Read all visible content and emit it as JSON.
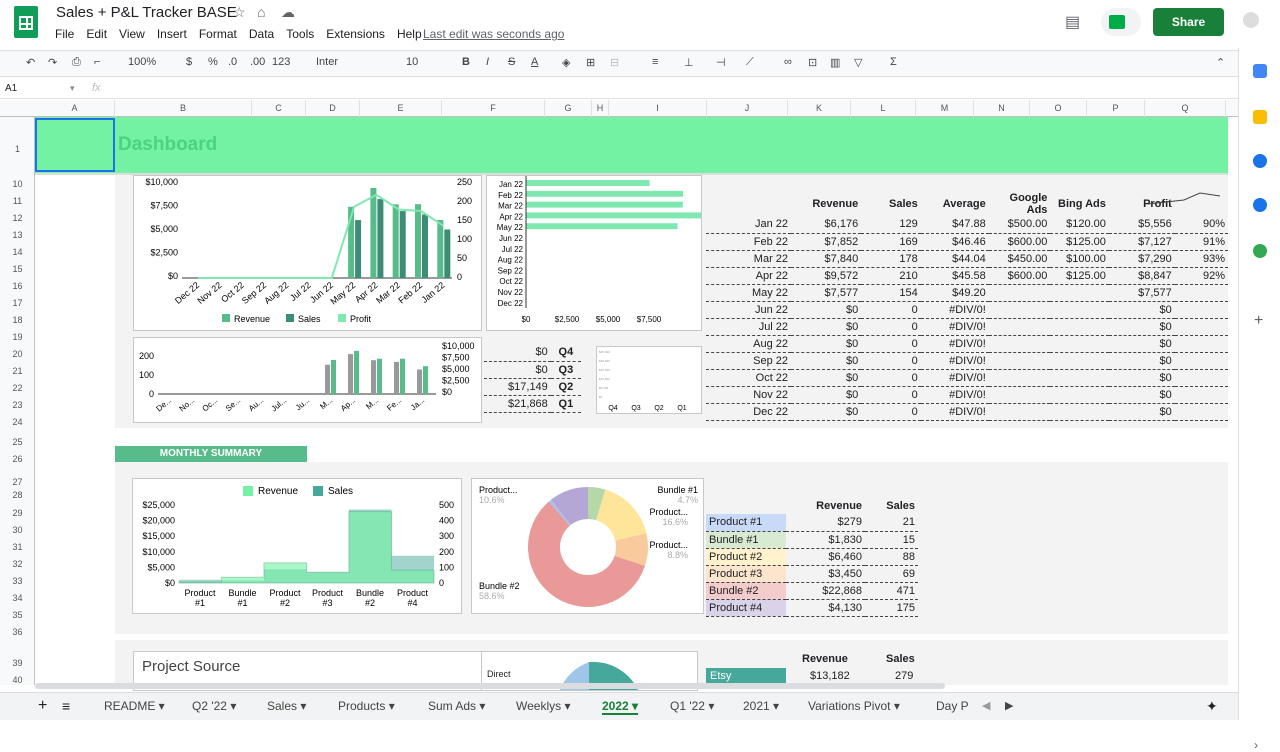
{
  "app": {
    "title": "Sales + P&L Tracker BASE",
    "last_edit": "Last edit was seconds ago",
    "share": "Share"
  },
  "menus": [
    "File",
    "Edit",
    "View",
    "Insert",
    "Format",
    "Data",
    "Tools",
    "Extensions",
    "Help"
  ],
  "toolbar": {
    "zoom": "100%",
    "currency": "$",
    "percent": "%",
    "dec_less": ".0",
    "dec_more": ".00",
    "format123": "123",
    "font": "Inter",
    "size": "10"
  },
  "formula_bar": {
    "cell_ref": "A1",
    "fx": "fx"
  },
  "columns": [
    "A",
    "B",
    "C",
    "D",
    "E",
    "F",
    "G",
    "H",
    "I",
    "J",
    "K",
    "L",
    "M",
    "N",
    "O",
    "P",
    "Q"
  ],
  "rows": [
    "1",
    "10",
    "11",
    "12",
    "13",
    "14",
    "15",
    "16",
    "17",
    "18",
    "19",
    "20",
    "21",
    "22",
    "23",
    "24",
    "25",
    "26",
    "27",
    "28",
    "29",
    "30",
    "31",
    "32",
    "33",
    "34",
    "35",
    "36",
    "39",
    "40"
  ],
  "dashboard_title": "Dashboard",
  "monthly_summary": "MONTHLY SUMMARY",
  "project_source": "Project Source",
  "chart1": {
    "y_left": [
      "$10,000",
      "$7,500",
      "$5,000",
      "$2,500",
      "$0"
    ],
    "y_right": [
      "250",
      "200",
      "150",
      "100",
      "50",
      "0"
    ],
    "x": [
      "Dec 22",
      "Nov 22",
      "Oct 22",
      "Sep 22",
      "Aug 22",
      "Jul 22",
      "Jun 22",
      "May 22",
      "Apr 22",
      "Mar 22",
      "Feb 22",
      "Jan 22"
    ],
    "legend": [
      "Revenue",
      "Sales",
      "Profit"
    ]
  },
  "chart2": {
    "months": [
      "Jan 22",
      "Feb 22",
      "Mar 22",
      "Apr 22",
      "May 22",
      "Jun 22",
      "Jul 22",
      "Aug 22",
      "Sep 22",
      "Oct 22",
      "Nov 22",
      "Dec 22"
    ],
    "x": [
      "$0",
      "$2,500",
      "$5,000",
      "$7,500"
    ]
  },
  "chart3": {
    "y_left": [
      "200",
      "100",
      "0"
    ],
    "y_right": [
      "$10,000",
      "$7,500",
      "$5,000",
      "$2,500",
      "$0"
    ],
    "x": [
      "De...",
      "No...",
      "Oc...",
      "Se...",
      "Au...",
      "Jul...",
      "Ju...",
      "M...",
      "Ap...",
      "M...",
      "Fe...",
      "Ja..."
    ]
  },
  "quarters": [
    {
      "v": "$0",
      "q": "Q4"
    },
    {
      "v": "$0",
      "q": "Q3"
    },
    {
      "v": "$17,149",
      "q": "Q2"
    },
    {
      "v": "$21,868",
      "q": "Q1"
    }
  ],
  "quarter_chart": {
    "x": [
      "Q4",
      "Q3",
      "Q2",
      "Q1"
    ]
  },
  "pl_table": {
    "headers": [
      "",
      "Revenue",
      "Sales",
      "Average",
      "Google Ads",
      "Bing Ads",
      "Profit",
      ""
    ],
    "rows": [
      [
        "Jan 22",
        "$6,176",
        "129",
        "$47.88",
        "$500.00",
        "$120.00",
        "$5,556",
        "90%"
      ],
      [
        "Feb 22",
        "$7,852",
        "169",
        "$46.46",
        "$600.00",
        "$125.00",
        "$7,127",
        "91%"
      ],
      [
        "Mar 22",
        "$7,840",
        "178",
        "$44.04",
        "$450.00",
        "$100.00",
        "$7,290",
        "93%"
      ],
      [
        "Apr 22",
        "$9,572",
        "210",
        "$45.58",
        "$600.00",
        "$125.00",
        "$8,847",
        "92%"
      ],
      [
        "May 22",
        "$7,577",
        "154",
        "$49.20",
        "",
        "",
        "$7,577",
        ""
      ],
      [
        "Jun 22",
        "$0",
        "0",
        "#DIV/0!",
        "",
        "",
        "$0",
        ""
      ],
      [
        "Jul 22",
        "$0",
        "0",
        "#DIV/0!",
        "",
        "",
        "$0",
        ""
      ],
      [
        "Aug 22",
        "$0",
        "0",
        "#DIV/0!",
        "",
        "",
        "$0",
        ""
      ],
      [
        "Sep 22",
        "$0",
        "0",
        "#DIV/0!",
        "",
        "",
        "$0",
        ""
      ],
      [
        "Oct 22",
        "$0",
        "0",
        "#DIV/0!",
        "",
        "",
        "$0",
        ""
      ],
      [
        "Nov 22",
        "$0",
        "0",
        "#DIV/0!",
        "",
        "",
        "$0",
        ""
      ],
      [
        "Dec 22",
        "$0",
        "0",
        "#DIV/0!",
        "",
        "",
        "$0",
        ""
      ]
    ]
  },
  "summary_chart": {
    "legend": [
      "Revenue",
      "Sales"
    ],
    "y_left": [
      "$25,000",
      "$20,000",
      "$15,000",
      "$10,000",
      "$5,000",
      "$0"
    ],
    "y_right": [
      "500",
      "400",
      "300",
      "200",
      "100",
      "0"
    ],
    "x": [
      "Product #1",
      "Bundle #1",
      "Product #2",
      "Product #3",
      "Bundle #2",
      "Product #4"
    ]
  },
  "pie": {
    "labels": [
      {
        "name": "Product...",
        "pct": "10.6%"
      },
      {
        "name": "Bundle #1",
        "pct": "4.7%"
      },
      {
        "name": "Product...",
        "pct": "16.6%"
      },
      {
        "name": "Product...",
        "pct": "8.8%"
      },
      {
        "name": "Bundle #2",
        "pct": "58.6%"
      }
    ]
  },
  "product_table": {
    "headers": [
      "",
      "Revenue",
      "Sales"
    ],
    "rows": [
      {
        "name": "Product #1",
        "rev": "$279",
        "sales": "21",
        "color": "#c9daf8"
      },
      {
        "name": "Bundle #1",
        "rev": "$1,830",
        "sales": "15",
        "color": "#d9ead3"
      },
      {
        "name": "Product #2",
        "rev": "$6,460",
        "sales": "88",
        "color": "#fff2cc"
      },
      {
        "name": "Product #3",
        "rev": "$3,450",
        "sales": "69",
        "color": "#fce5cd"
      },
      {
        "name": "Bundle #2",
        "rev": "$22,868",
        "sales": "471",
        "color": "#f4cccc"
      },
      {
        "name": "Product #4",
        "rev": "$4,130",
        "sales": "175",
        "color": "#d9d2e9"
      }
    ]
  },
  "bottom_table": {
    "headers": [
      "Revenue",
      "Sales"
    ],
    "row": {
      "name": "Etsy",
      "rev": "$13,182",
      "sales": "279"
    },
    "direct": "Direct"
  },
  "tabs": [
    "README",
    "Q2 '22",
    "Sales",
    "Products",
    "Sum Ads",
    "Weeklys",
    "2022",
    "Q1 '22",
    "2021",
    "Variations Pivot",
    "Day P"
  ],
  "active_tab": "2022"
}
